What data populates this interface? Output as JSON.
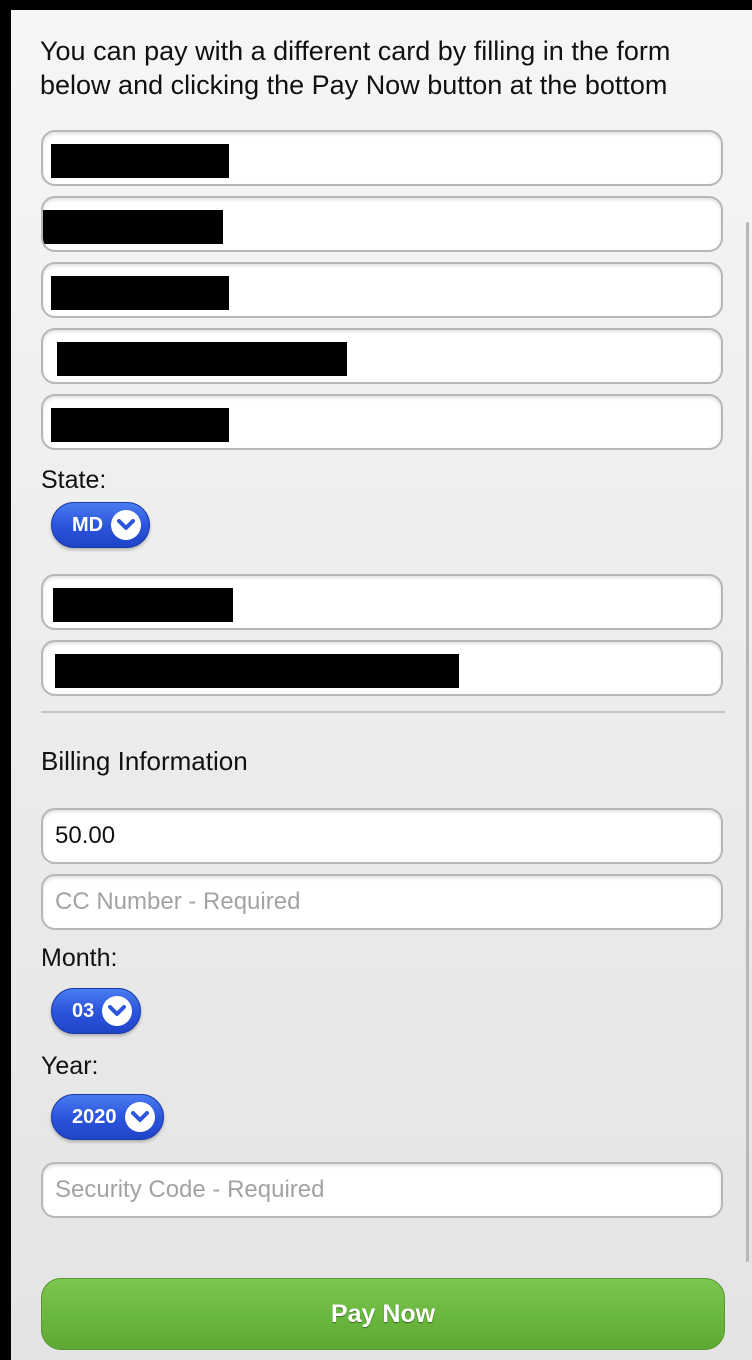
{
  "intro_text": "You can pay with a different card by filling in the form below and clicking the Pay Now button at the bottom",
  "address": {
    "state_label": "State:",
    "state_value": "MD"
  },
  "billing": {
    "title": "Billing Information",
    "amount_value": "50.00",
    "cc_placeholder": "CC Number - Required",
    "month_label": "Month:",
    "month_value": "03",
    "year_label": "Year:",
    "year_value": "2020",
    "security_placeholder": "Security Code - Required"
  },
  "pay_button_label": "Pay Now",
  "colors": {
    "select_blue": "#2c55dc",
    "pay_green": "#6bb83f"
  },
  "icons": {
    "select": "chevron-down-icon"
  }
}
